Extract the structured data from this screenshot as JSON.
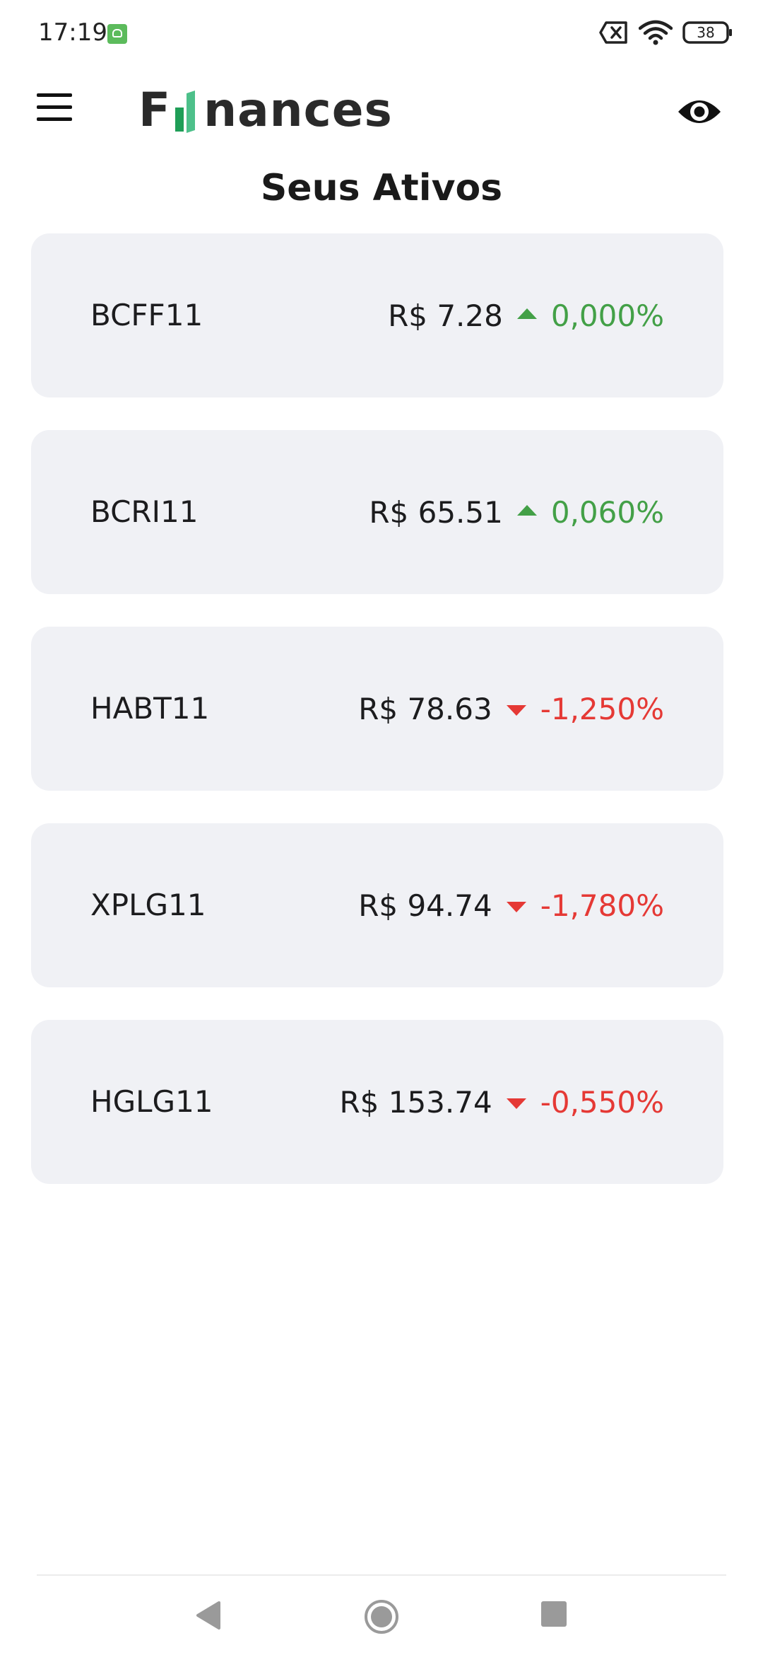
{
  "status_bar": {
    "time": "17:19",
    "battery": "38",
    "icons": [
      "app-notification-icon",
      "sim-off-icon",
      "wifi-icon",
      "battery-icon"
    ]
  },
  "app_bar": {
    "logo_prefix": "F",
    "logo_suffix": "nances",
    "icons": [
      "menu-icon",
      "eye-icon"
    ]
  },
  "page": {
    "title": "Seus Ativos"
  },
  "assets": [
    {
      "ticker": "BCFF11",
      "price": "R$ 7.28",
      "change": "0,000%",
      "direction": "up"
    },
    {
      "ticker": "BCRI11",
      "price": "R$ 65.51",
      "change": "0,060%",
      "direction": "up"
    },
    {
      "ticker": "HABT11",
      "price": "R$ 78.63",
      "change": "-1,250%",
      "direction": "down"
    },
    {
      "ticker": "XPLG11",
      "price": "R$ 94.74",
      "change": "-1,780%",
      "direction": "down"
    },
    {
      "ticker": "HGLG11",
      "price": "R$ 153.74",
      "change": "-0,550%",
      "direction": "down"
    }
  ],
  "colors": {
    "positive": "#43a047",
    "negative": "#e53935",
    "card_background": "#f0f1f5",
    "logo_green_dark": "#1f9e57",
    "logo_green_light": "#4dc08a"
  },
  "nav_bar": {
    "icons": [
      "back-icon",
      "home-icon",
      "recents-icon"
    ]
  }
}
